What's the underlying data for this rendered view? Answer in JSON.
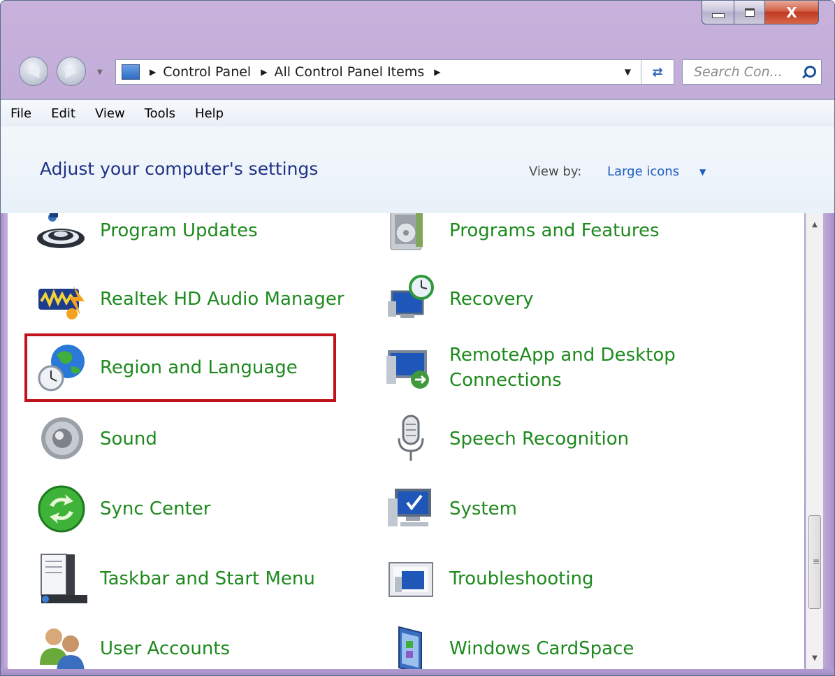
{
  "window": {
    "close_label": "X"
  },
  "address_bar": {
    "breadcrumbs": [
      "Control Panel",
      "All Control Panel Items"
    ],
    "search_placeholder": "Search Con..."
  },
  "menu": [
    "File",
    "Edit",
    "View",
    "Tools",
    "Help"
  ],
  "header": {
    "title": "Adjust your computer's settings",
    "view_by_label": "View by:",
    "view_by_value": "Large icons"
  },
  "items": [
    {
      "label": "Program Updates",
      "icon": "program-updates-icon"
    },
    {
      "label": "Programs and Features",
      "icon": "programs-features-icon"
    },
    {
      "label": "Realtek HD Audio Manager",
      "icon": "realtek-audio-icon"
    },
    {
      "label": "Recovery",
      "icon": "recovery-icon"
    },
    {
      "label": "Region and Language",
      "icon": "region-language-icon",
      "highlighted": true
    },
    {
      "label": "RemoteApp and Desktop",
      "label2": "Connections",
      "icon": "remoteapp-icon"
    },
    {
      "label": "Sound",
      "icon": "sound-icon"
    },
    {
      "label": "Speech Recognition",
      "icon": "microphone-icon"
    },
    {
      "label": "Sync Center",
      "icon": "sync-center-icon"
    },
    {
      "label": "System",
      "icon": "system-icon"
    },
    {
      "label": "Taskbar and Start Menu",
      "icon": "taskbar-icon"
    },
    {
      "label": "Troubleshooting",
      "icon": "troubleshooting-icon"
    },
    {
      "label": "User Accounts",
      "icon": "user-accounts-icon"
    },
    {
      "label": "Windows CardSpace",
      "icon": "cardspace-icon"
    }
  ],
  "colors": {
    "link_green": "#1e8a1e",
    "highlight_red": "#c0121a",
    "title_blue": "#1e3287"
  }
}
